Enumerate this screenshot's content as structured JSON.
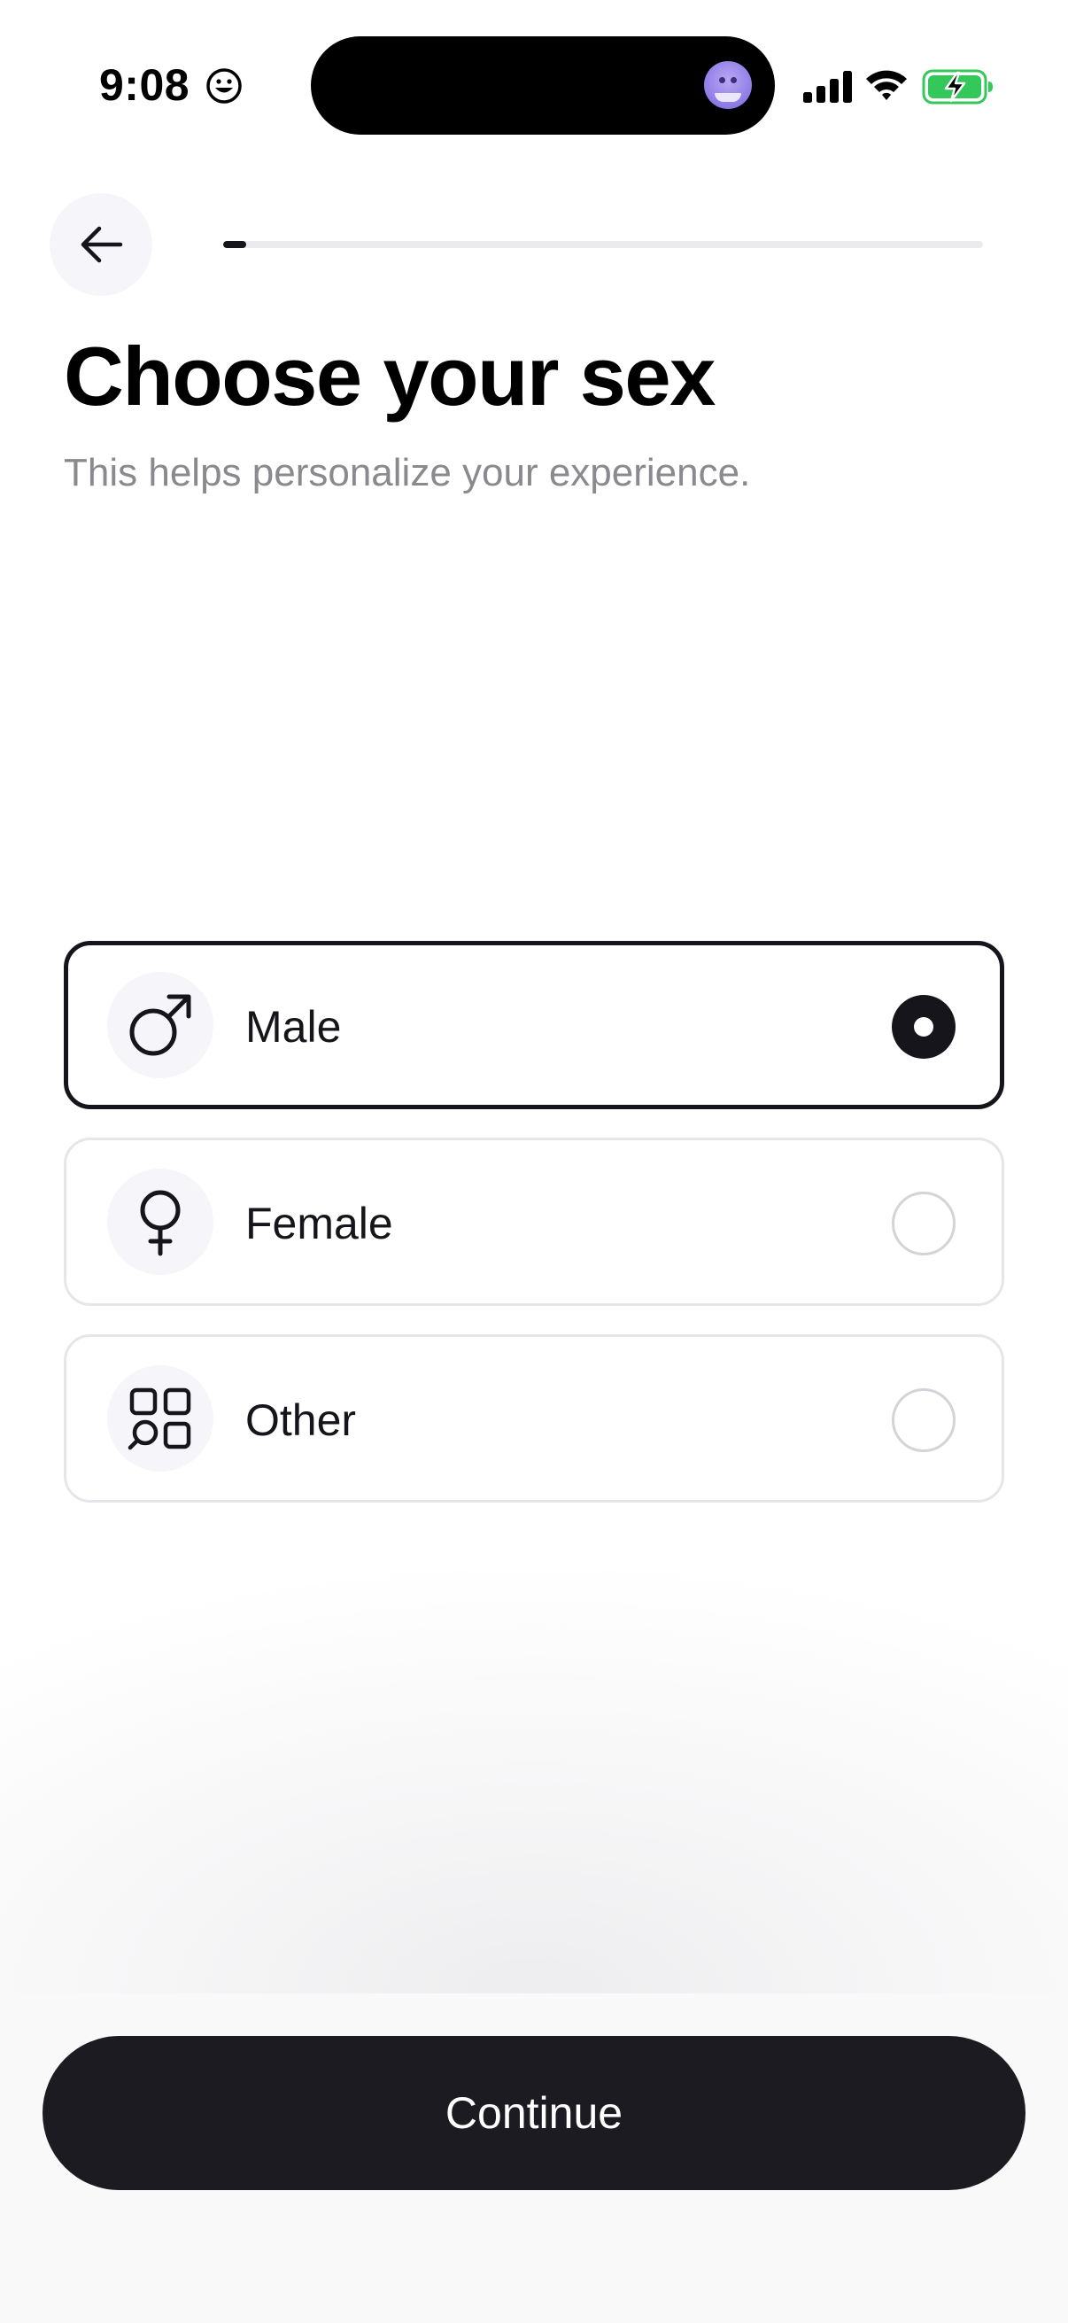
{
  "status_bar": {
    "time": "9:08",
    "emoji_icon": "smiley-face-icon",
    "signal_icon": "cellular-signal-icon",
    "wifi_icon": "wifi-icon",
    "battery_icon": "battery-charging-icon",
    "battery_color": "#34c759"
  },
  "header": {
    "back_icon": "arrow-left-icon",
    "progress_fraction": 0.03
  },
  "page": {
    "title": "Choose your sex",
    "subtitle": "This helps personalize your experience."
  },
  "options": [
    {
      "label": "Male",
      "icon": "male-symbol-icon",
      "selected": true
    },
    {
      "label": "Female",
      "icon": "female-symbol-icon",
      "selected": false
    },
    {
      "label": "Other",
      "icon": "shapes-grid-icon",
      "selected": false
    }
  ],
  "footer": {
    "continue_label": "Continue"
  },
  "colors": {
    "primary": "#16151b",
    "subtitle_text": "#8a8a8e",
    "icon_bg": "#f6f6fa"
  }
}
